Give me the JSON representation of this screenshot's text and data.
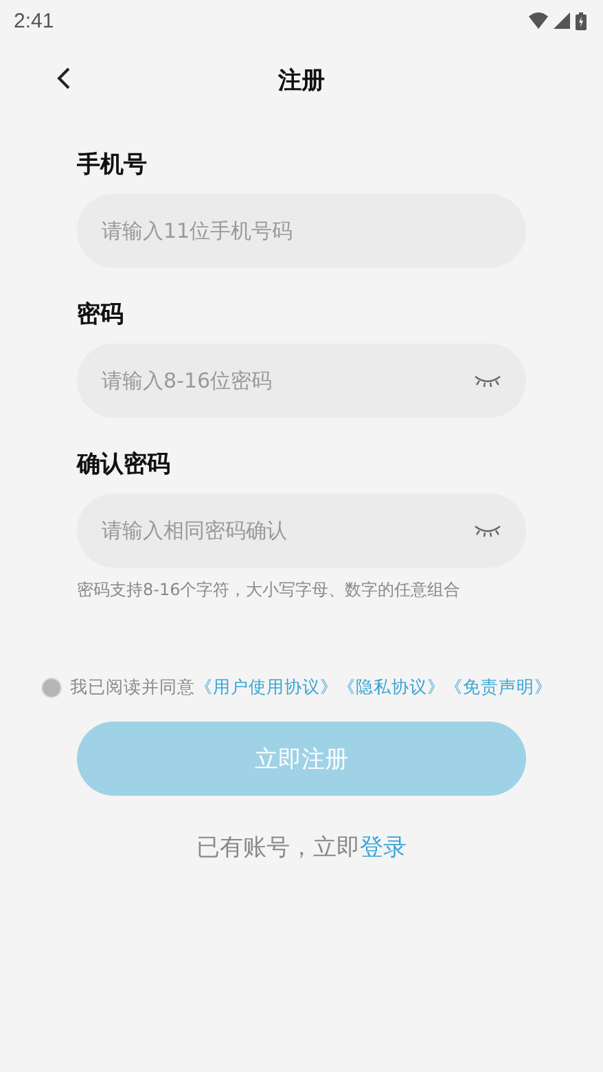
{
  "status_bar": {
    "time": "2:41"
  },
  "header": {
    "title": "注册"
  },
  "fields": [
    {
      "kind": "phone",
      "label": "手机号",
      "placeholder": "请输入11位手机号码"
    },
    {
      "kind": "password",
      "label": "密码",
      "placeholder": "请输入8-16位密码"
    },
    {
      "kind": "password",
      "label": "确认密码",
      "placeholder": "请输入相同密码确认"
    }
  ],
  "hint": "密码支持8-16个字符，大小写字母、数字的任意组合",
  "agreement": {
    "checked": false,
    "text": "我已阅读并同意",
    "links": [
      "《用户使用协议》",
      "《隐私协议》",
      "《免责声明》"
    ]
  },
  "submit": {
    "label": "立即注册",
    "disabled": true
  },
  "login_prompt": {
    "text": "已有账号，立即",
    "link": "登录"
  }
}
